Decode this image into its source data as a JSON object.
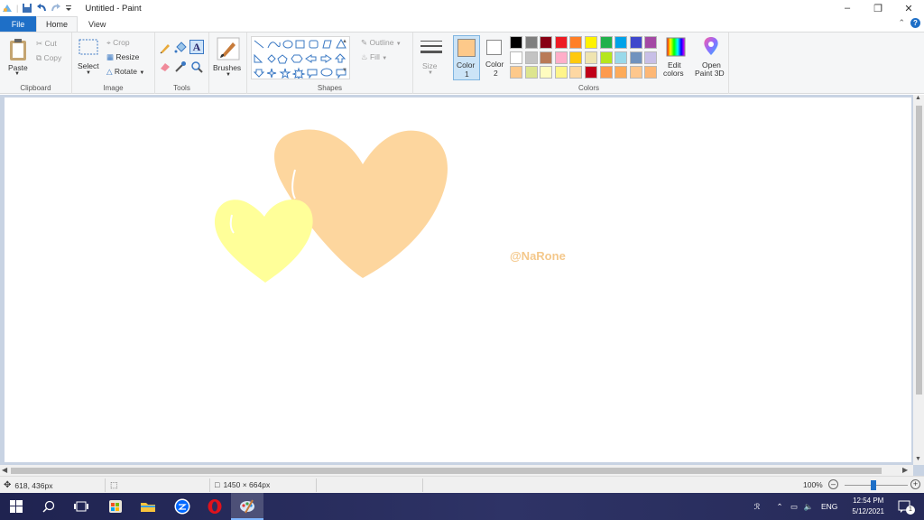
{
  "window": {
    "title": "Untitled - Paint"
  },
  "tabs": {
    "file": "File",
    "home": "Home",
    "view": "View"
  },
  "clipboard": {
    "paste": "Paste",
    "cut": "Cut",
    "copy": "Copy",
    "group": "Clipboard"
  },
  "image": {
    "select": "Select",
    "crop": "Crop",
    "resize": "Resize",
    "rotate": "Rotate",
    "group": "Image"
  },
  "tools": {
    "group": "Tools"
  },
  "brushes": {
    "label": "Brushes"
  },
  "shapes": {
    "outline": "Outline",
    "fill": "Fill",
    "group": "Shapes"
  },
  "size": {
    "label": "Size"
  },
  "colors": {
    "color1": "Color",
    "color1_num": "1",
    "color2": "Color",
    "color2_num": "2",
    "color1_value": "#fdc98a",
    "color2_value": "#ffffff",
    "edit_colors_1": "Edit",
    "edit_colors_2": "colors",
    "group": "Colors",
    "palette_row1": [
      "#000000",
      "#7f7f7f",
      "#880015",
      "#ed1c24",
      "#ff7f27",
      "#fff200",
      "#22b14c",
      "#00a2e8",
      "#3f48cc",
      "#a349a4"
    ],
    "palette_row2": [
      "#ffffff",
      "#c3c3c3",
      "#b97a57",
      "#ffaec9",
      "#ffc90e",
      "#efe4b0",
      "#b5e61d",
      "#99d9ea",
      "#7092be",
      "#c8bfe7"
    ],
    "palette_row3": [
      "#fdc98a",
      "#dde58f",
      "#fffcc0",
      "#fff58a",
      "#fdd7a2",
      "#c00018",
      "#fd9a4e",
      "#fdab5a",
      "#fec78d",
      "#fdb775"
    ]
  },
  "paint3d": {
    "line1": "Open",
    "line2": "Paint 3D"
  },
  "canvas": {
    "watermark": "@NaRone",
    "heart_big_color": "#fdd69e",
    "heart_small_color": "#ffff99"
  },
  "status": {
    "cursor": "618, 436px",
    "size": "1450 × 664px",
    "zoom": "100%"
  },
  "taskbar": {
    "lang": "ENG",
    "time": "12:54 PM",
    "date": "5/12/2021",
    "notif": "1"
  }
}
